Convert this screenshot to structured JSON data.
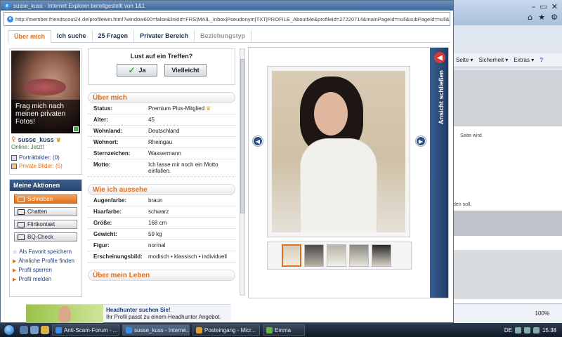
{
  "popup": {
    "title": "susse_kuss - Internet Explorer bereitgestellt von 1&1",
    "url": "http://member.friendscout24.de/profilewin.html?window600=false&linkId=FRS|MAIL_Inbox|Pseudonym|TXT|PROFILE_AboutMe&profileId=27220714&mainPageId=null&subPageId=null&"
  },
  "tabs": [
    "Über mich",
    "Ich suche",
    "25 Fragen",
    "Privater Bereich",
    "Beziehungstyp"
  ],
  "profile": {
    "caption": "Frag mich nach meinen privaten Fotos!",
    "username": "susse_kuss",
    "online": "Online: Jetzt!",
    "portrait_link": "Porträtbilder: (0)",
    "private_link": "Private Bilder: (5)"
  },
  "actions": {
    "heading": "Meine Aktionen",
    "buttons": [
      "Schreiben",
      "Chatten",
      "Flirtkontakt",
      "BQ-Check"
    ],
    "links": [
      "Als Favorit speichern",
      "Ähnliche Profile finden",
      "Profil sperren",
      "Profil melden"
    ]
  },
  "meet": {
    "question": "Lust auf ein Treffen?",
    "yes": "Ja",
    "maybe": "Vielleicht"
  },
  "about": {
    "heading": "Über mich",
    "rows": [
      {
        "k": "Status:",
        "v": "Premium Plus-Mitglied"
      },
      {
        "k": "Alter:",
        "v": "45"
      },
      {
        "k": "Wohnland:",
        "v": "Deutschland"
      },
      {
        "k": "Wohnort:",
        "v": "Rheingau"
      },
      {
        "k": "Sternzeichen:",
        "v": "Wassermann"
      },
      {
        "k": "Motto:",
        "v": "Ich lasse mir noch ein Motto einfallen."
      }
    ]
  },
  "looks": {
    "heading": "Wie ich aussehe",
    "rows": [
      {
        "k": "Augenfarbe:",
        "v": "braun"
      },
      {
        "k": "Haarfarbe:",
        "v": "schwarz"
      },
      {
        "k": "Größe:",
        "v": "168 cm"
      },
      {
        "k": "Gewicht:",
        "v": "59 kg"
      },
      {
        "k": "Figur:",
        "v": "normal"
      },
      {
        "k": "Erscheinungsbild:",
        "v": "modisch • klassisch • individuell"
      }
    ]
  },
  "life": {
    "heading": "Über mein Leben"
  },
  "gallery": {
    "close_label": "Ansicht schließen"
  },
  "ad": {
    "title": "Headhunter suchen Sie!",
    "text": "Ihr Profil passt zu einem Headhunter Angebot."
  },
  "bg_window": {
    "menu": [
      "Seite ▾",
      "Sicherheit ▾",
      "Extras ▾"
    ],
    "text1": "Seite wird",
    "text2": "den soll.",
    "zoom": "100%"
  },
  "taskbar": {
    "items": [
      "Anti-Scam-Forum - ...",
      "susse_kuss - Interne...",
      "Posteingang - Micr...",
      "Emma"
    ],
    "lang": "DE",
    "time": "15:38"
  }
}
